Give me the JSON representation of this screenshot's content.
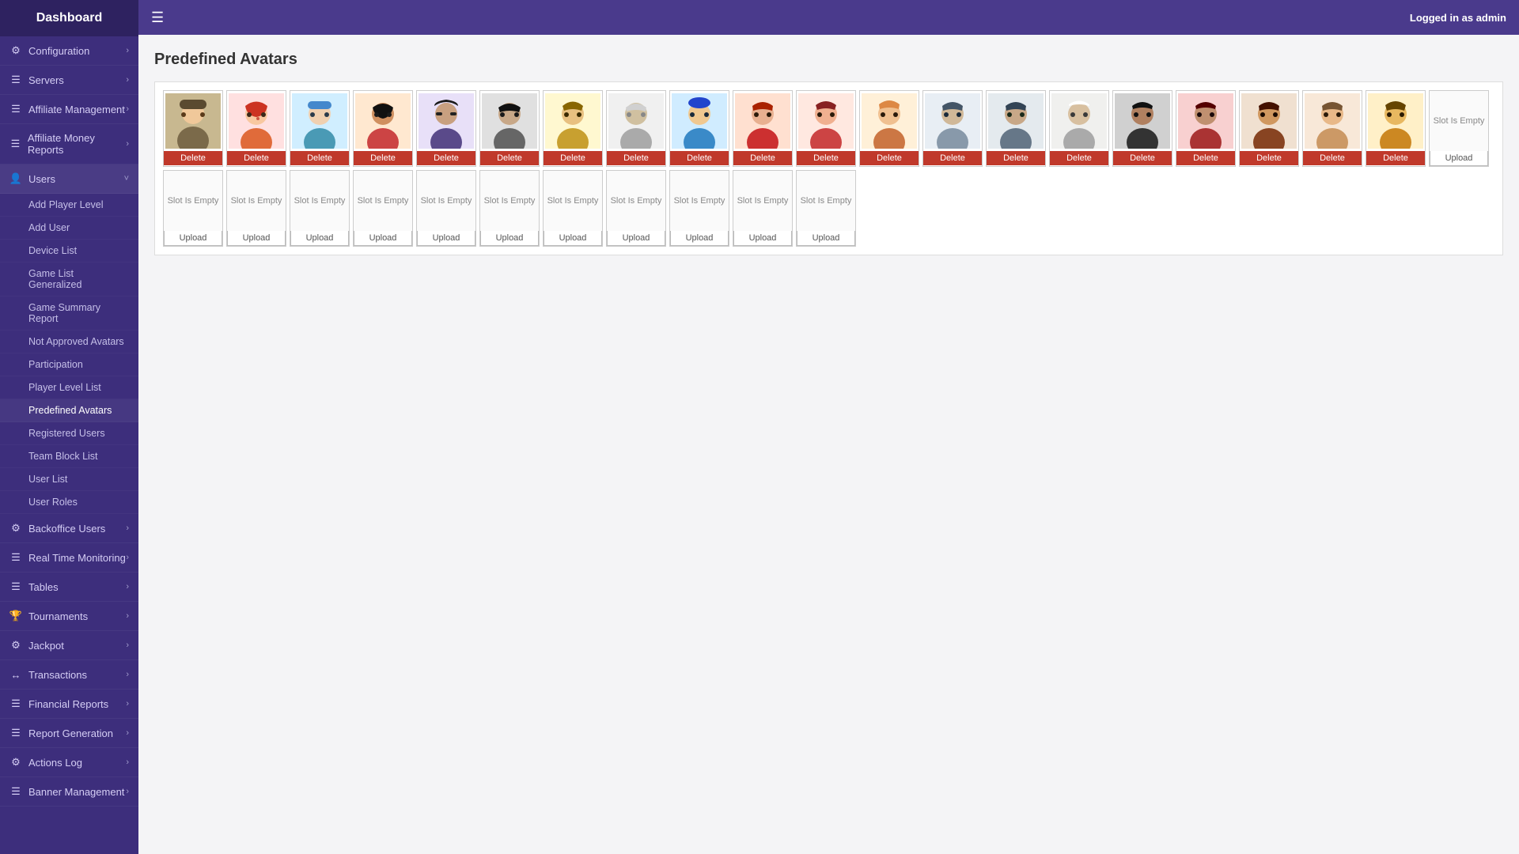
{
  "sidebar": {
    "title": "Dashboard",
    "items": [
      {
        "id": "configuration",
        "icon": "⚙",
        "label": "Configuration",
        "hasChevron": true
      },
      {
        "id": "servers",
        "icon": "☰",
        "label": "Servers",
        "hasChevron": true
      },
      {
        "id": "affiliate-management",
        "icon": "☰",
        "label": "Affiliate Management",
        "hasChevron": true
      },
      {
        "id": "affiliate-money-reports",
        "icon": "☰",
        "label": "Affiliate Money Reports",
        "hasChevron": true
      },
      {
        "id": "users",
        "icon": "👤",
        "label": "Users",
        "hasChevron": true,
        "expanded": true
      },
      {
        "id": "backoffice-users",
        "icon": "⚙",
        "label": "Backoffice Users",
        "hasChevron": true
      },
      {
        "id": "real-time-monitoring",
        "icon": "☰",
        "label": "Real Time Monitoring",
        "hasChevron": true
      },
      {
        "id": "tables",
        "icon": "☰",
        "label": "Tables",
        "hasChevron": true
      },
      {
        "id": "tournaments",
        "icon": "🏆",
        "label": "Tournaments",
        "hasChevron": true
      },
      {
        "id": "jackpot",
        "icon": "⚙",
        "label": "Jackpot",
        "hasChevron": true
      },
      {
        "id": "transactions",
        "icon": "↔",
        "label": "Transactions",
        "hasChevron": true
      },
      {
        "id": "financial-reports",
        "icon": "☰",
        "label": "Financial Reports",
        "hasChevron": true
      },
      {
        "id": "report-generation",
        "icon": "☰",
        "label": "Report Generation",
        "hasChevron": true
      },
      {
        "id": "actions-log",
        "icon": "⚙",
        "label": "Actions Log",
        "hasChevron": true
      },
      {
        "id": "banner-management",
        "icon": "☰",
        "label": "Banner Management",
        "hasChevron": true
      }
    ],
    "sub_items": [
      "Add Player Level",
      "Add User",
      "Device List",
      "Game List Generalized",
      "Game Summary Report",
      "Not Approved Avatars",
      "Participation",
      "Player Level List",
      "Predefined Avatars",
      "Registered Users",
      "Team Block List",
      "User List",
      "User Roles"
    ]
  },
  "topbar": {
    "logged_in_text": "Logged in as",
    "username": "admin"
  },
  "page": {
    "title": "Predefined Avatars"
  },
  "avatars": {
    "row1": [
      {
        "type": "filled",
        "color": "#7b6a4a"
      },
      {
        "type": "filled",
        "color": "#e06b3a"
      },
      {
        "type": "filled",
        "color": "#4a9ab5"
      },
      {
        "type": "filled",
        "color": "#cc4444"
      },
      {
        "type": "filled",
        "color": "#5a4a8a"
      },
      {
        "type": "filled",
        "color": "#6b6b6b"
      },
      {
        "type": "filled",
        "color": "#c8a030"
      },
      {
        "type": "filled",
        "color": "#aaaaaa"
      },
      {
        "type": "filled",
        "color": "#3a8ac8"
      },
      {
        "type": "filled",
        "color": "#cc3030"
      },
      {
        "type": "filled",
        "color": "#cc4444"
      },
      {
        "type": "filled",
        "color": "#cc7744"
      },
      {
        "type": "filled",
        "color": "#8899aa"
      },
      {
        "type": "filled",
        "color": "#667788"
      },
      {
        "type": "filled",
        "color": "#aaaaaa"
      }
    ],
    "row2": [
      {
        "type": "filled",
        "color": "#333333"
      },
      {
        "type": "filled",
        "color": "#aa3333"
      },
      {
        "type": "filled",
        "color": "#884422"
      },
      {
        "type": "filled",
        "color": "#cc9966"
      },
      {
        "type": "filled",
        "color": "#cc8822"
      },
      {
        "type": "empty"
      },
      {
        "type": "empty"
      },
      {
        "type": "empty"
      },
      {
        "type": "empty"
      },
      {
        "type": "empty"
      },
      {
        "type": "empty"
      },
      {
        "type": "empty"
      },
      {
        "type": "empty"
      },
      {
        "type": "empty"
      },
      {
        "type": "empty"
      }
    ],
    "row3": [
      {
        "type": "empty"
      },
      {
        "type": "empty"
      }
    ],
    "delete_label": "Delete",
    "upload_label": "Upload",
    "slot_empty_label": "Slot Is Empty"
  }
}
